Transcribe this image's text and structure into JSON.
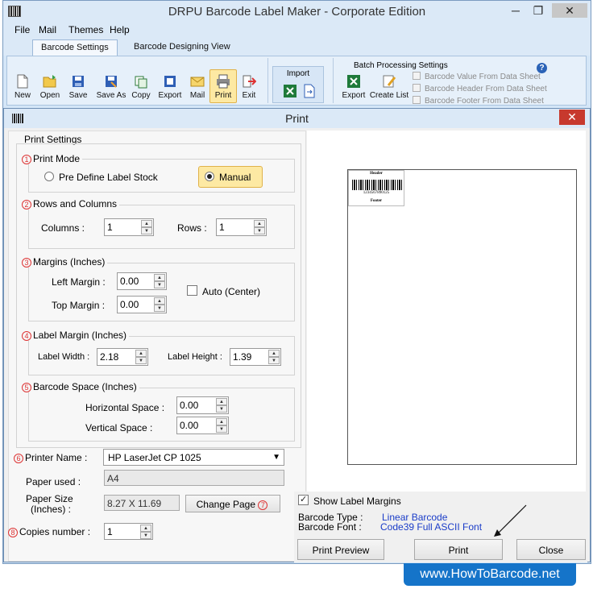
{
  "window": {
    "title": "DRPU Barcode Label Maker - Corporate Edition",
    "minimize": "─",
    "maximize": "❐",
    "close": "✕"
  },
  "menu": [
    "File",
    "Mail",
    "Themes",
    "Help"
  ],
  "tabs": [
    "Barcode Settings",
    "Barcode Designing View"
  ],
  "toolbar": {
    "buttons": [
      "New",
      "Open",
      "Save",
      "Save As",
      "Copy",
      "Export",
      "Mail",
      "Print",
      "Exit"
    ],
    "import_label": "Import",
    "batch_title": "Batch Processing Settings",
    "batch_export": "Export",
    "batch_create_list": "Create List",
    "batch_options": [
      "Barcode Value From Data Sheet",
      "Barcode Header From Data Sheet",
      "Barcode Footer From Data Sheet"
    ],
    "help": "?"
  },
  "dialog": {
    "title": "Print",
    "close": "✕",
    "print_settings": "Print Settings",
    "print_mode": {
      "num": "1",
      "title": "Print Mode",
      "option_predefine": "Pre Define Label Stock",
      "option_manual": "Manual",
      "selected": "Manual"
    },
    "rows_cols": {
      "num": "2",
      "title": "Rows and Columns",
      "columns_label": "Columns :",
      "columns_value": "1",
      "rows_label": "Rows :",
      "rows_value": "1"
    },
    "margins": {
      "num": "3",
      "title": "Margins (Inches)",
      "left_label": "Left Margin :",
      "left_value": "0.00",
      "top_label": "Top Margin :",
      "top_value": "0.00",
      "auto_label": "Auto (Center)"
    },
    "label_margin": {
      "num": "4",
      "title": "Label Margin (Inches)",
      "width_label": "Label Width :",
      "width_value": "2.18",
      "height_label": "Label Height :",
      "height_value": "1.39"
    },
    "barcode_space": {
      "num": "5",
      "title": "Barcode Space (Inches)",
      "horizontal_label": "Horizontal Space :",
      "horizontal_value": "0.00",
      "vertical_label": "Vertical Space :",
      "vertical_value": "0.00"
    },
    "printer": {
      "num": "6",
      "label": "Printer Name :",
      "value": "HP LaserJet CP 1025"
    },
    "paper_used": {
      "label": "Paper used :",
      "value": "A4"
    },
    "paper_size": {
      "label_line1": "Paper Size",
      "label_line2": "(Inches) :",
      "value": "8.27 X 11.69"
    },
    "change_page": {
      "label": "Change Page",
      "num": "7"
    },
    "copies": {
      "num": "8",
      "label": "Copies number :",
      "value": "1"
    },
    "preview": {
      "header": "Header",
      "number": "1234567890125",
      "footer": "Footer"
    },
    "show_margins": "Show Label Margins",
    "barcode_type_label": "Barcode Type :",
    "barcode_type_value": "Linear Barcode",
    "barcode_font_label": "Barcode Font :",
    "barcode_font_value": "Code39 Full ASCII Font",
    "btn_preview": "Print Preview",
    "btn_print": "Print",
    "btn_close": "Close"
  },
  "watermark": "www.HowToBarcode.net"
}
